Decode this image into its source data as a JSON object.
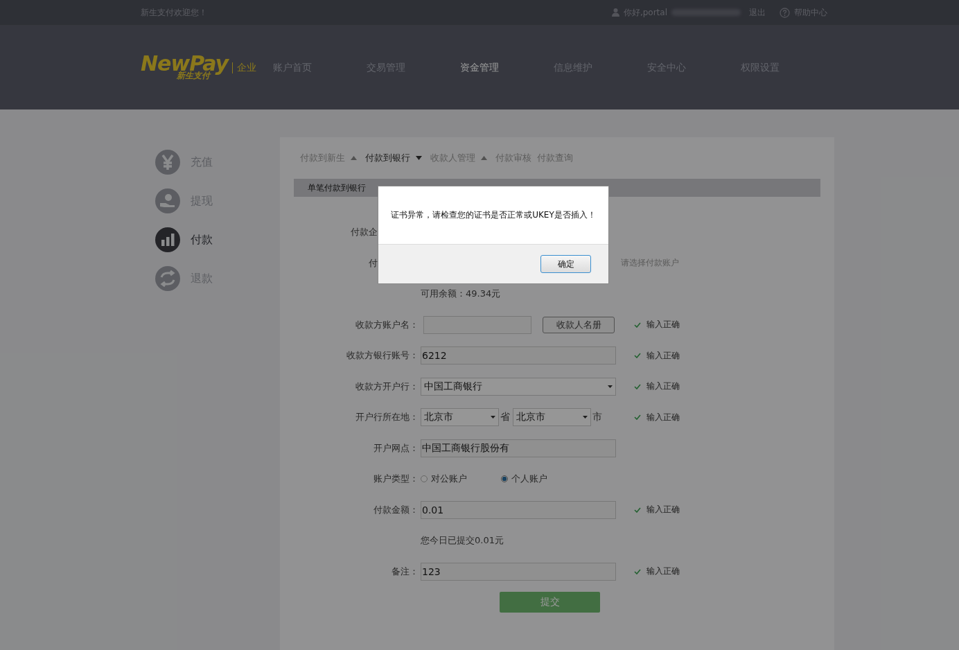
{
  "top_bar": {
    "welcome": "新生支付欢迎您！",
    "greeting": "你好,portal",
    "logout": "退出",
    "help": "帮助中心"
  },
  "header": {
    "logo": "NewPay",
    "logo_sub": "新生支付",
    "edition": "企业",
    "nav": [
      {
        "label": "账户首页",
        "selected": false
      },
      {
        "label": "交易管理",
        "selected": false
      },
      {
        "label": "资金管理",
        "selected": true
      },
      {
        "label": "信息维护",
        "selected": false
      },
      {
        "label": "安全中心",
        "selected": false
      },
      {
        "label": "权限设置",
        "selected": false
      }
    ]
  },
  "sidebar": {
    "items": [
      {
        "label": "充值",
        "selected": false
      },
      {
        "label": "提现",
        "selected": false
      },
      {
        "label": "付款",
        "selected": true
      },
      {
        "label": "退款",
        "selected": false
      }
    ]
  },
  "tabs": [
    {
      "label": "付款到新生",
      "selected": false,
      "expanded": false
    },
    {
      "label": "付款到银行",
      "selected": true,
      "expanded": true
    },
    {
      "label": "收款人管理",
      "selected": false,
      "expanded": false
    },
    {
      "label": "付款审核",
      "selected": false
    },
    {
      "label": "付款查询",
      "selected": false
    }
  ],
  "subtabs": [
    {
      "label": "单笔付款到银行",
      "selected": true
    }
  ],
  "form": [
    {
      "kind": "label",
      "label": "付款企"
    },
    {
      "kind": "hint",
      "label": "付",
      "hint": "请选择付款账户"
    },
    {
      "kind": "note",
      "text": "可用余额：49.34元"
    },
    {
      "kind": "input_button",
      "label": "收款方账户名：",
      "button": "收款人名册",
      "status": "输入正确"
    },
    {
      "kind": "input",
      "label": "收款方银行账号：",
      "value": "6212",
      "status": "输入正确"
    },
    {
      "kind": "select",
      "label": "收款方开户行：",
      "value": "中国工商银行",
      "status": "输入正确"
    },
    {
      "kind": "region",
      "label": "开户行所在地：",
      "province": "北京市",
      "province_unit": "省",
      "city": "北京市",
      "city_unit": "市",
      "status": "输入正确"
    },
    {
      "kind": "input",
      "label": "开户网点：",
      "value": "中国工商银行股份有"
    },
    {
      "kind": "radio",
      "label": "账户类型：",
      "options": [
        {
          "label": "对公账户",
          "selected": false
        },
        {
          "label": "个人账户",
          "selected": true
        }
      ]
    },
    {
      "kind": "input",
      "label": "付款金额：",
      "value": "0.01",
      "status": "输入正确"
    },
    {
      "kind": "note",
      "text": "您今日已提交0.01元"
    },
    {
      "kind": "input",
      "label": "备注：",
      "value": "123",
      "status": "输入正确"
    },
    {
      "kind": "submit",
      "button": "提交"
    }
  ],
  "dialog": {
    "message": "证书异常，请检查您的证书是否正常或UKEY是否插入！",
    "button": "确定"
  }
}
